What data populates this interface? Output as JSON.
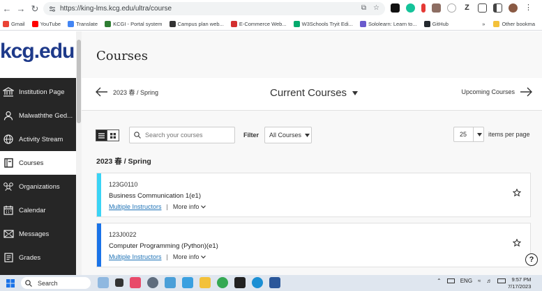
{
  "browser": {
    "url": "https://king-lms.kcg.edu/ultra/course",
    "bookmarks": [
      {
        "label": "Gmail",
        "color": "#ea4335"
      },
      {
        "label": "YouTube",
        "color": "#ff0000"
      },
      {
        "label": "Translate",
        "color": "#4285f4"
      },
      {
        "label": "KCGI - Portal system",
        "color": "#2e7d32"
      },
      {
        "label": "Campus plan web...",
        "color": "#333333"
      },
      {
        "label": "E-Commerce Web...",
        "color": "#d32f2f"
      },
      {
        "label": "W3Schools Tryit Edi...",
        "color": "#04aa6d"
      },
      {
        "label": "Sololearn: Learn to...",
        "color": "#6a5acd"
      },
      {
        "label": "GitHub",
        "color": "#24292e"
      }
    ],
    "other_bookmarks": "Other bookma"
  },
  "sidebar": {
    "logo": "kcg.edu",
    "items": [
      {
        "label": "Institution Page",
        "icon": "institution-icon"
      },
      {
        "label": "Malwaththe Ged...",
        "icon": "user-icon"
      },
      {
        "label": "Activity Stream",
        "icon": "globe-icon"
      },
      {
        "label": "Courses",
        "icon": "courses-icon"
      },
      {
        "label": "Organizations",
        "icon": "organizations-icon"
      },
      {
        "label": "Calendar",
        "icon": "calendar-icon"
      },
      {
        "label": "Messages",
        "icon": "envelope-icon"
      },
      {
        "label": "Grades",
        "icon": "grades-icon"
      }
    ],
    "active_index": 3
  },
  "main": {
    "title": "Courses",
    "term_prev": "2023 春 / Spring",
    "term_current": "Current Courses",
    "term_next": "Upcoming Courses",
    "search_placeholder": "Search your courses",
    "filter_label": "Filter",
    "filter_value": "All Courses",
    "per_page_value": "25",
    "per_page_label": "items per page",
    "group_heading": "2023 春 / Spring",
    "courses": [
      {
        "id": "123G0110",
        "name": "Business Communication 1(e1)",
        "instructors": "Multiple Instructors",
        "more": "More info",
        "color": "#3ad4f5"
      },
      {
        "id": "123J0022",
        "name": "Computer Programming (Python)(e1)",
        "instructors": "Multiple Instructors",
        "more": "More info",
        "color": "#1a73e8"
      }
    ]
  },
  "taskbar": {
    "search": "Search",
    "language": "ENG",
    "time": "9:57 PM",
    "date": "7/17/2023"
  },
  "colors": {
    "sidebar_bg": "#262626",
    "logo": "#1e3a8a",
    "link": "#1f73b7"
  }
}
